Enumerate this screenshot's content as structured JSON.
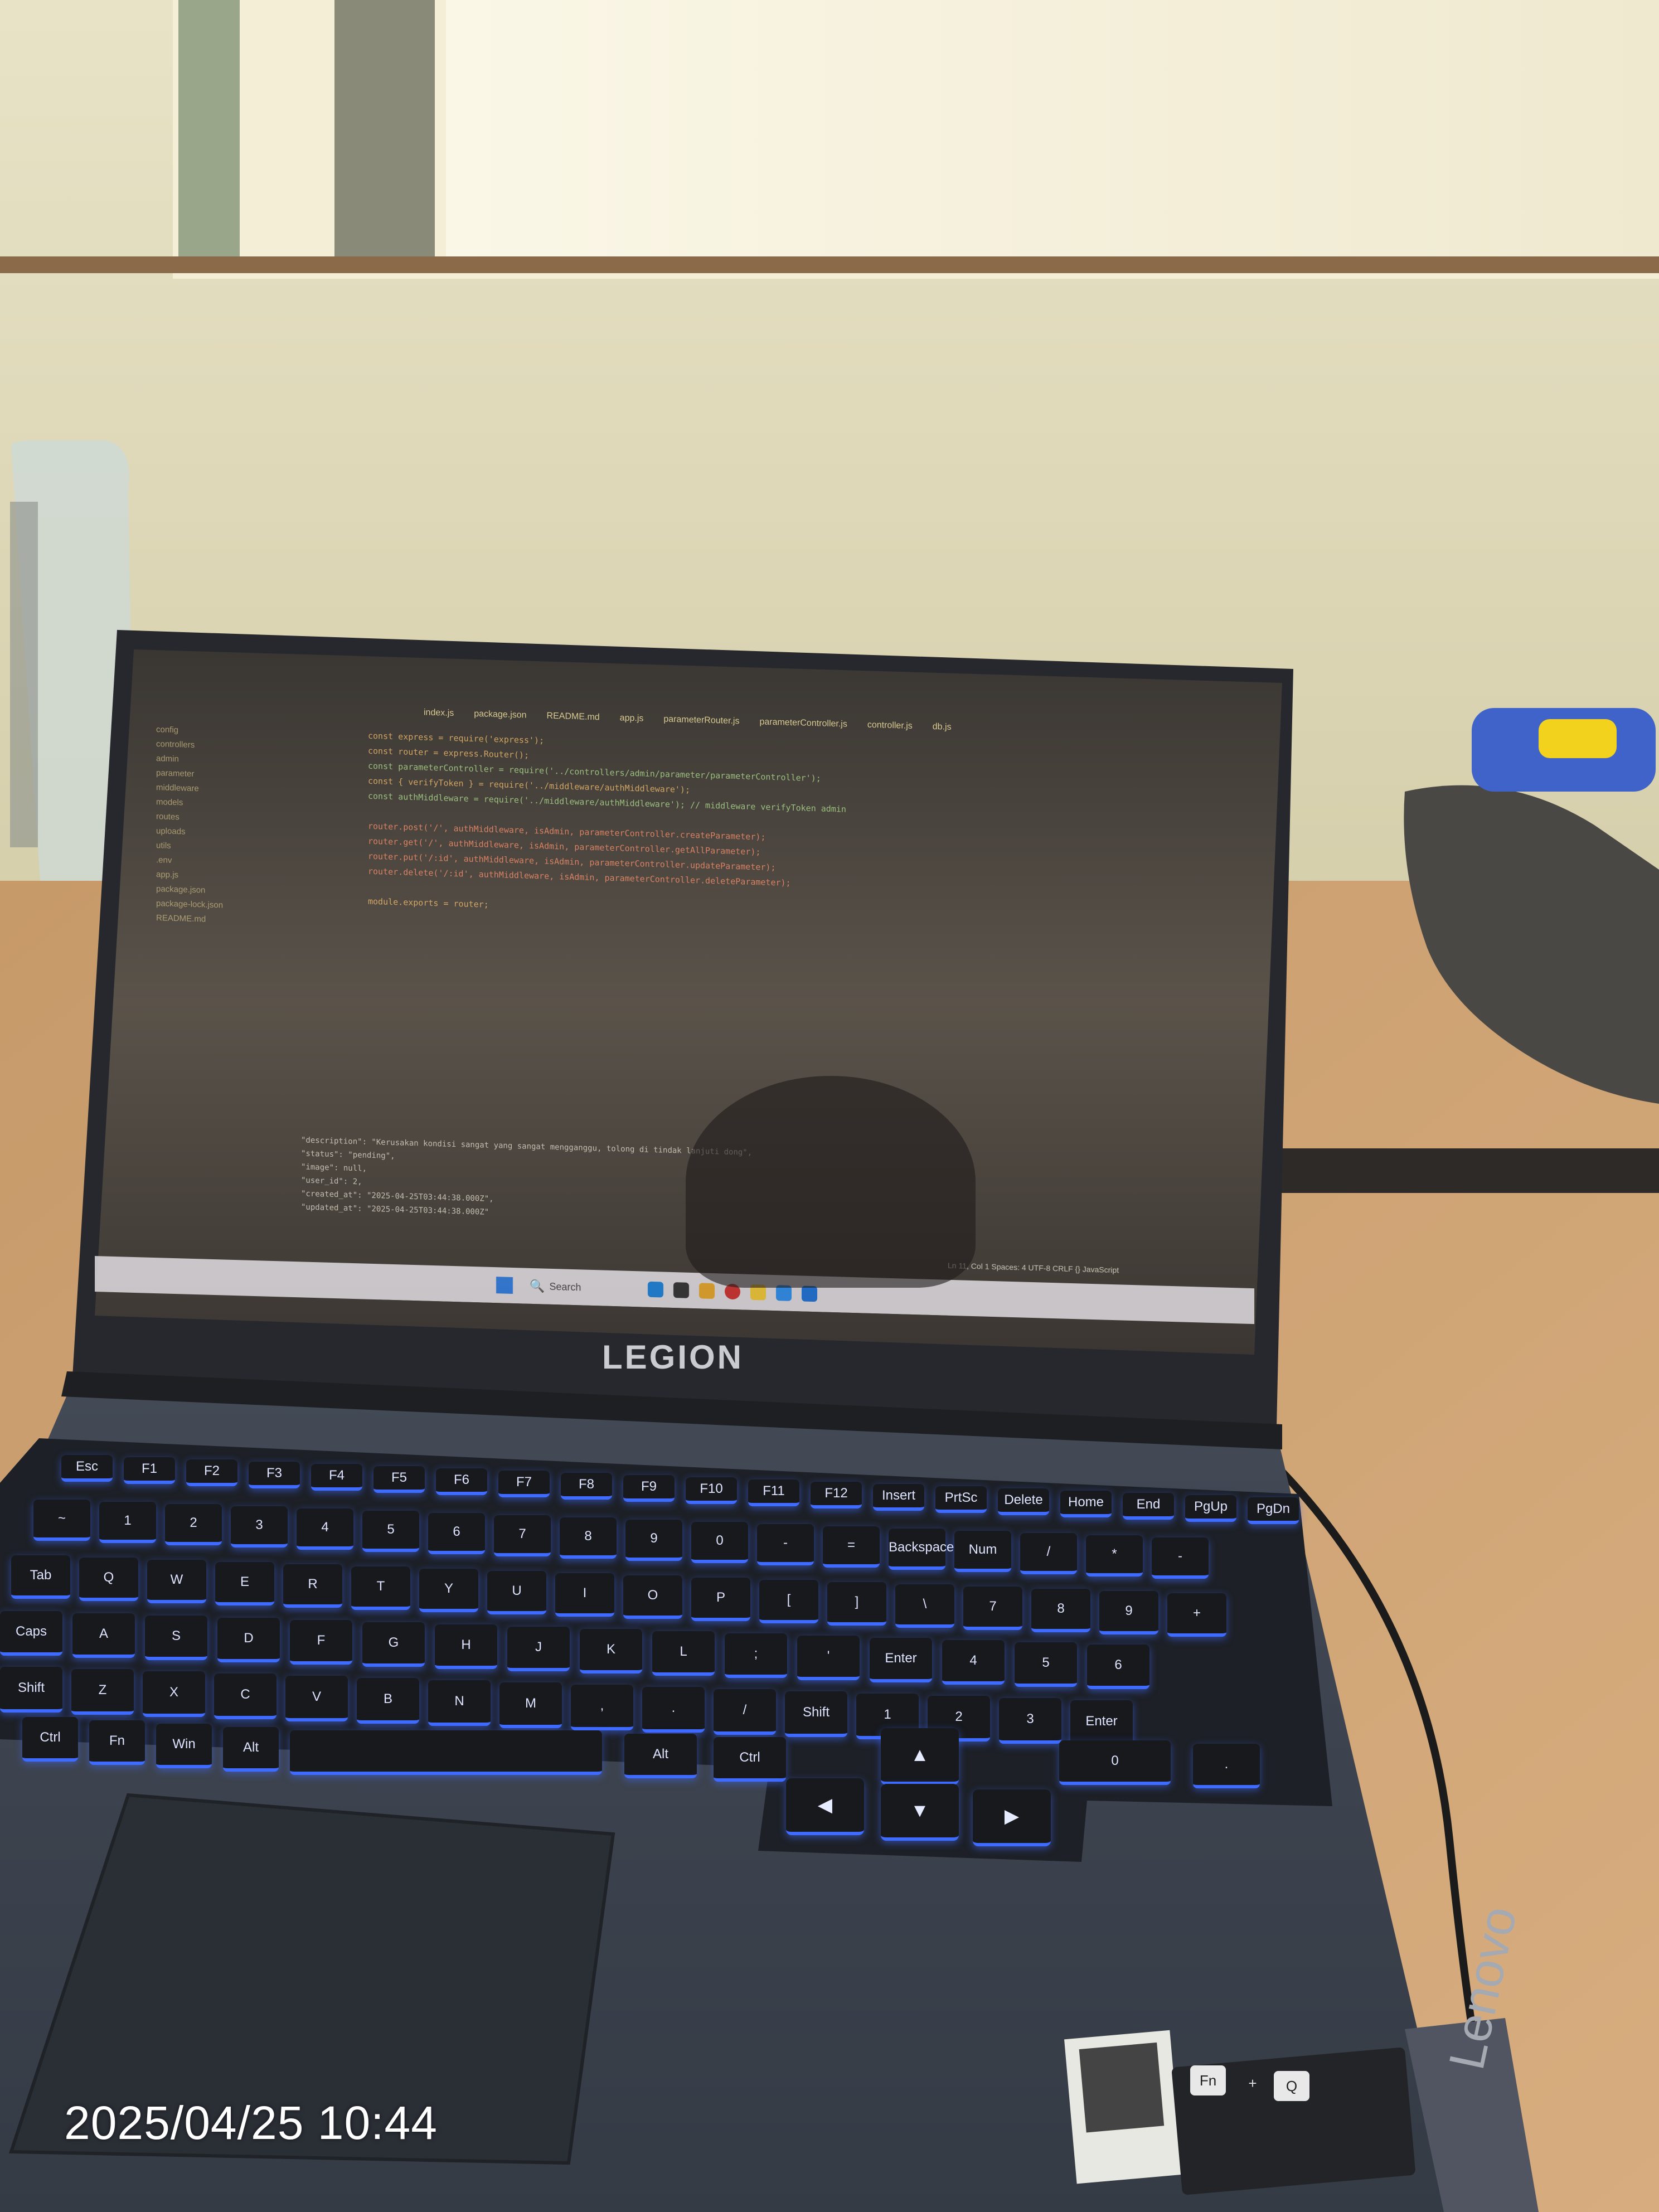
{
  "photo": {
    "timestamp": "2025/04/25 10:44",
    "brand_logo": "LEGION",
    "lid_brand": "Lenovo",
    "accent_colors": {
      "keyboard_backlight": "#3f6bff",
      "wall": "#dcd6b6",
      "desk": "#c99a6a",
      "chassis": "#3c434e"
    }
  },
  "screen": {
    "editor_tabs": [
      "index.js",
      "package.json",
      "README.md",
      "app.js",
      "parameterRouter.js",
      "parameterController.js",
      "controller.js",
      "db.js"
    ],
    "code_lines": [
      "const express = require('express');",
      "const router = express.Router();",
      "const parameterController = require('../controllers/admin/parameter/parameterController');",
      "const { verifyToken } = require('../middleware/authMiddleware');",
      "const authMiddleware = require('../middleware/authMiddleware'); // middleware verifyToken admin",
      "",
      "router.post('/', authMiddleware, isAdmin, parameterController.createParameter);",
      "router.get('/', authMiddleware, isAdmin, parameterController.getAllParameter);",
      "router.put('/:id', authMiddleware, isAdmin, parameterController.updateParameter);",
      "router.delete('/:id', authMiddleware, isAdmin, parameterController.deleteParameter);",
      "",
      "module.exports = router;"
    ],
    "terminal_lines": [
      "\"description\": \"Kerusakan kondisi sangat yang sangat mengganggu, tolong di tindak lanjuti dong\",",
      "\"status\": \"pending\",",
      "\"image\": null,",
      "\"user_id\": 2,",
      "\"created_at\": \"2025-04-25T03:44:38.000Z\",",
      "\"updated_at\": \"2025-04-25T03:44:38.000Z\""
    ],
    "status_bar": "Ln 11, Col 1   Spaces: 4   UTF-8   CRLF   {} JavaScript",
    "taskbar_search": "Search",
    "sidebar_items": [
      "config",
      "controllers",
      "admin",
      "parameter",
      "middleware",
      "models",
      "routes",
      "uploads",
      "utils",
      ".env",
      "app.js",
      "package.json",
      "package-lock.json",
      "README.md"
    ]
  },
  "keyboard": {
    "row_fn": [
      "Esc",
      "F1",
      "F2",
      "F3",
      "F4",
      "F5",
      "F6",
      "F7",
      "F8",
      "F9",
      "F10",
      "F11",
      "F12",
      "Insert",
      "PrtSc",
      "Delete",
      "Home",
      "End",
      "PgUp",
      "PgDn"
    ],
    "row_num": [
      "~",
      "1",
      "2",
      "3",
      "4",
      "5",
      "6",
      "7",
      "8",
      "9",
      "0",
      "-",
      "=",
      "Backspace",
      "Num",
      "/",
      "*",
      "-"
    ],
    "row_q": [
      "Tab",
      "Q",
      "W",
      "E",
      "R",
      "T",
      "Y",
      "U",
      "I",
      "O",
      "P",
      "[",
      "]",
      "\\",
      "7",
      "8",
      "9",
      "+"
    ],
    "row_a": [
      "Caps",
      "A",
      "S",
      "D",
      "F",
      "G",
      "H",
      "J",
      "K",
      "L",
      ";",
      "'",
      "Enter",
      "4",
      "5",
      "6"
    ],
    "row_z": [
      "Shift",
      "Z",
      "X",
      "C",
      "V",
      "B",
      "N",
      "M",
      ",",
      ".",
      "/",
      "Shift",
      "1",
      "2",
      "3",
      "Enter"
    ],
    "row_bottom": [
      "Ctrl",
      "Fn",
      "Win",
      "Alt",
      "",
      "Alt",
      "Ctrl",
      "0",
      "."
    ],
    "arrows": [
      "▲",
      "◀",
      "▼",
      "▶"
    ],
    "sticker_keys": [
      "Fn",
      "+",
      "Q"
    ]
  }
}
